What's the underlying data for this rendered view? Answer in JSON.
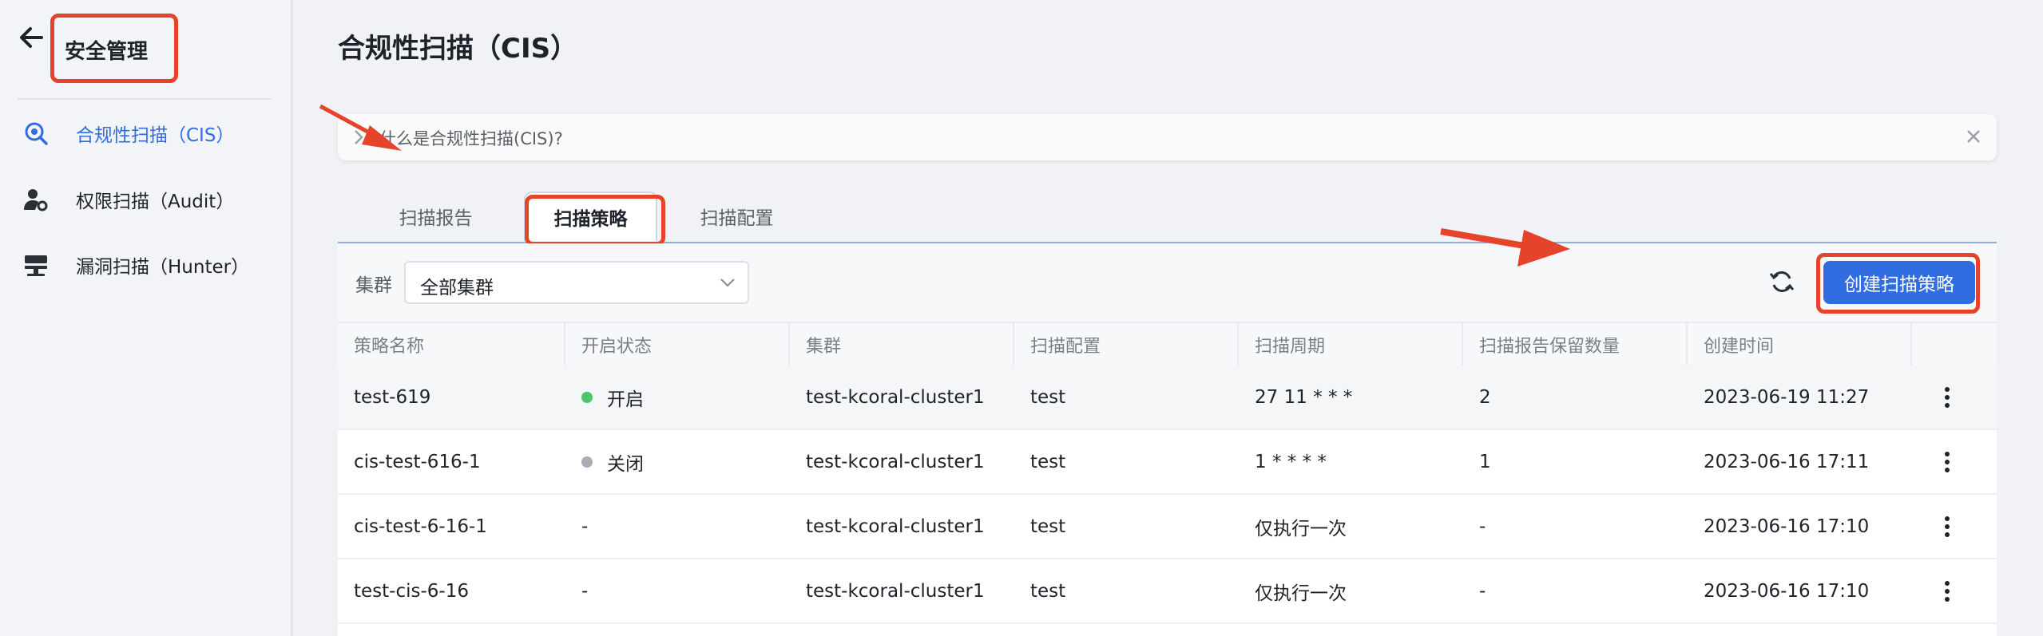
{
  "colors": {
    "accent": "#2f6de1",
    "highlight": "#e5432a",
    "status_on": "#4bc46c",
    "status_off": "#a9adb5"
  },
  "sidebar": {
    "title": "安全管理",
    "back_icon": "arrow-left-icon",
    "items": [
      {
        "label": "合规性扫描（CIS）",
        "icon": "compliance-scan-icon",
        "active": true
      },
      {
        "label": "权限扫描（Audit）",
        "icon": "user-gear-icon",
        "active": false
      },
      {
        "label": "漏洞扫描（Hunter）",
        "icon": "server-stack-icon",
        "active": false
      }
    ]
  },
  "page": {
    "title": "合规性扫描（CIS）",
    "info": "什么是合规性扫描(CIS)?"
  },
  "tabs": [
    {
      "label": "扫描报告",
      "active": false
    },
    {
      "label": "扫描策略",
      "active": true
    },
    {
      "label": "扫描配置",
      "active": false
    }
  ],
  "toolbar": {
    "cluster_label": "集群",
    "cluster_value": "全部集群",
    "create_label": "创建扫描策略"
  },
  "table": {
    "columns": [
      "策略名称",
      "开启状态",
      "集群",
      "扫描配置",
      "扫描周期",
      "扫描报告保留数量",
      "创建时间"
    ],
    "rows": [
      {
        "name": "test-619",
        "status": "开启",
        "status_type": "on",
        "cluster": "test-kcoral-cluster1",
        "config": "test",
        "cycle": "27 11 * * *",
        "retain": "2",
        "created": "2023-06-19 11:27"
      },
      {
        "name": "cis-test-616-1",
        "status": "关闭",
        "status_type": "off",
        "cluster": "test-kcoral-cluster1",
        "config": "test",
        "cycle": "1 * * * *",
        "retain": "1",
        "created": "2023-06-16 17:11"
      },
      {
        "name": "cis-test-6-16-1",
        "status": "-",
        "status_type": "none",
        "cluster": "test-kcoral-cluster1",
        "config": "test",
        "cycle": "仅执行一次",
        "retain": "-",
        "created": "2023-06-16 17:10"
      },
      {
        "name": "test-cis-6-16",
        "status": "-",
        "status_type": "none",
        "cluster": "test-kcoral-cluster1",
        "config": "test",
        "cycle": "仅执行一次",
        "retain": "-",
        "created": "2023-06-16 17:10"
      }
    ]
  }
}
